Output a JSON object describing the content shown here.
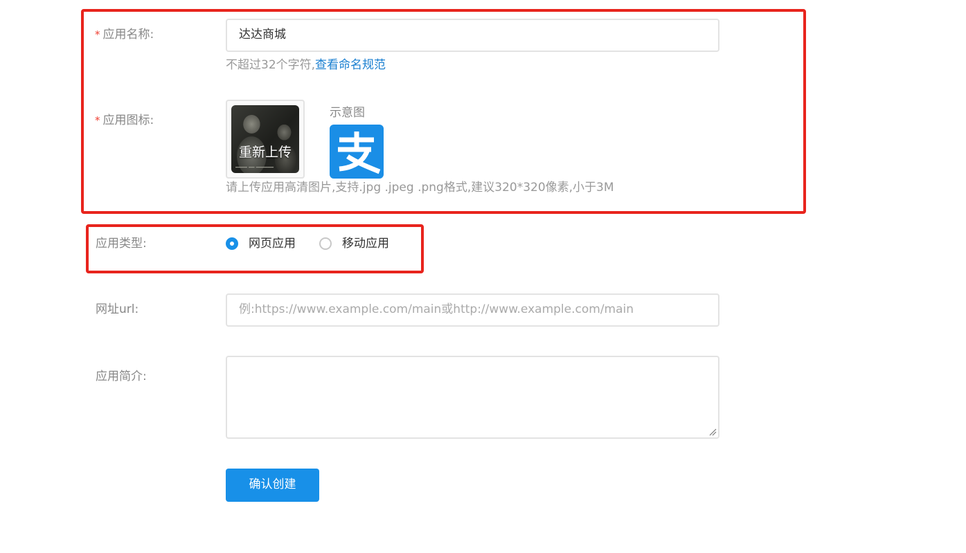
{
  "form": {
    "app_name": {
      "required_mark": "*",
      "label": "应用名称:",
      "value": "达达商城",
      "hint_prefix": "不超过32个字符,",
      "hint_link": "查看命名规范"
    },
    "app_icon": {
      "required_mark": "*",
      "label": "应用图标:",
      "reupload_label": "重新上传",
      "preview_title": "示意图",
      "hint": "请上传应用高清图片,支持.jpg .jpeg .png格式,建议320*320像素,小于3M"
    },
    "app_type": {
      "label": "应用类型:",
      "options": [
        {
          "label": "网页应用",
          "checked": true
        },
        {
          "label": "移动应用",
          "checked": false
        }
      ]
    },
    "url": {
      "label": "网址url:",
      "placeholder": "例:https://www.example.com/main或http://www.example.com/main"
    },
    "intro": {
      "label": "应用简介:",
      "value": ""
    },
    "submit_label": "确认创建"
  },
  "colors": {
    "accent": "#1890e8",
    "link": "#1a7fd0",
    "required": "#f04134",
    "highlight_box": "#e8241d"
  }
}
